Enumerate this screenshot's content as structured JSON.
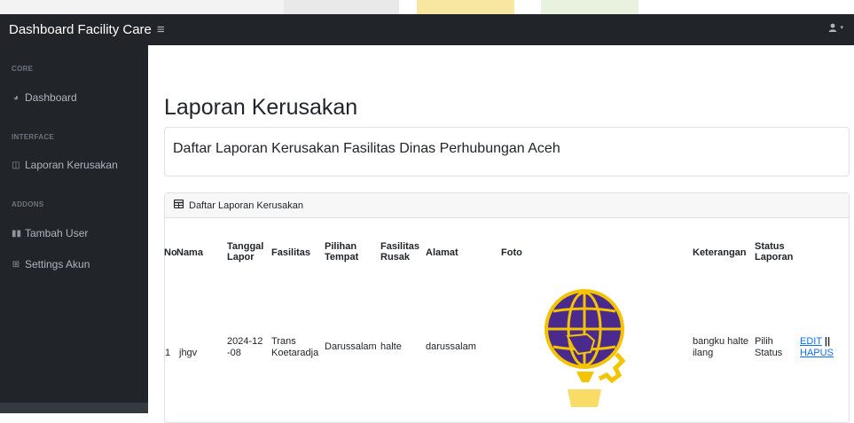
{
  "app": {
    "brand": "Dashboard Facility Care",
    "toggle_icon": "menu-icon",
    "user_icon": "user-icon"
  },
  "sidebar": {
    "sections": [
      {
        "heading": "CORE",
        "items": [
          {
            "label": "Dashboard",
            "icon": "speedometer-icon"
          }
        ]
      },
      {
        "heading": "INTERFACE",
        "items": [
          {
            "label": "Laporan Kerusakan",
            "icon": "columns-icon"
          }
        ]
      },
      {
        "heading": "ADDONS",
        "items": [
          {
            "label": "Tambah User",
            "icon": "book-icon"
          },
          {
            "label": "Settings Akun",
            "icon": "table-icon"
          }
        ]
      }
    ]
  },
  "main": {
    "title": "Laporan Kerusakan",
    "subtitle": "Daftar Laporan Kerusakan Fasilitas Dinas Perhubungan Aceh",
    "table_card_title": "Daftar Laporan Kerusakan",
    "columns": [
      "No",
      "Nama",
      "Tanggal Lapor",
      "Fasilitas",
      "Pilihan Tempat",
      "Fasilitas Rusak",
      "Alamat",
      "Foto",
      "Keterangan",
      "Status Laporan"
    ],
    "rows": [
      {
        "no": "1",
        "nama": "jhgv",
        "tanggal": "2024-12-08",
        "fasilitas": "Trans Koetaradja",
        "tempat": "Darussalam",
        "rusak": "halte",
        "alamat": "darussalam",
        "keterangan": "bangku halte ilang",
        "status": "Pilih Status",
        "edit": "EDIT",
        "sep": "||",
        "hapus": "HAPUS"
      }
    ]
  }
}
